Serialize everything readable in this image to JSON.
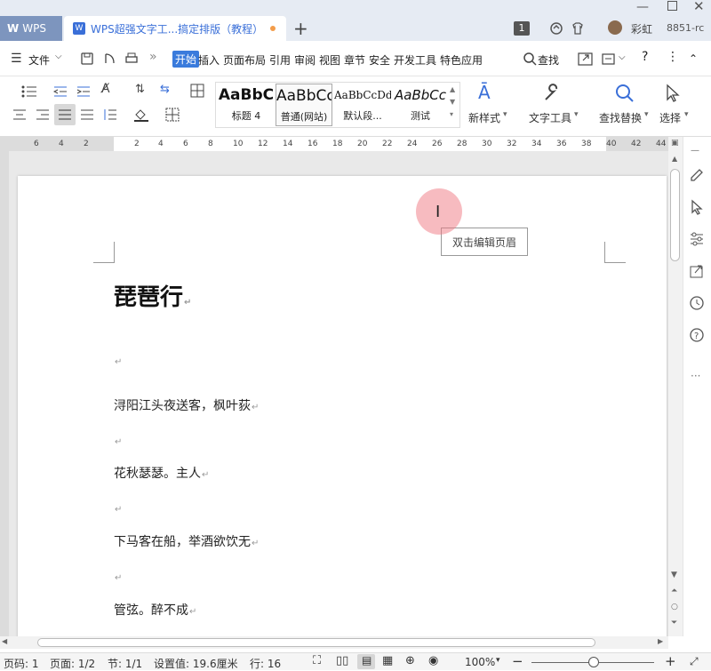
{
  "titlebar": {
    "app_tab": "WPS",
    "doc_tab": "WPS超强文字工...搞定排版（教程）",
    "add_tab": "+",
    "badge_num": "1",
    "user_name": "彩虹",
    "user_id": "8851-rc"
  },
  "menubar": {
    "file": "文件",
    "more": "»",
    "items": [
      "开始",
      "插入",
      "页面布局",
      "引用",
      "审阅",
      "视图",
      "章节",
      "安全",
      "开发工具",
      "特色应用"
    ],
    "search": "查找",
    "help": "?",
    "overflow": "⋮"
  },
  "ribbon": {
    "styles": [
      {
        "preview": "AaBbC",
        "label": "标题 4"
      },
      {
        "preview": "AaBbCcI",
        "label": "普通(网站)"
      },
      {
        "preview": "AaBbCcDd",
        "label": "默认段..."
      },
      {
        "preview": "AaBbCc",
        "label": "测试"
      }
    ],
    "new_style": "新样式",
    "text_tools": "文字工具",
    "find_replace": "查找替换",
    "select": "选择"
  },
  "ruler_ticks": [
    "6",
    "4",
    "2",
    "2",
    "4",
    "6",
    "8",
    "10",
    "12",
    "14",
    "16",
    "18",
    "20",
    "22",
    "24",
    "26",
    "28",
    "30",
    "32",
    "34",
    "36",
    "38",
    "40",
    "42",
    "44"
  ],
  "document": {
    "tooltip": "双击编辑页眉",
    "title": "琵琶行",
    "para_mark": "↵",
    "lines": [
      "浔阳江头夜送客，枫叶荻",
      "花秋瑟瑟。主人",
      "下马客在船，举酒欲饮无",
      "管弦。醉不成"
    ]
  },
  "status": {
    "page_no": "页码: 1",
    "page": "页面: 1/2",
    "section": "节: 1/1",
    "setting": "设置值: 19.6厘米",
    "row": "行: 16",
    "zoom": "100%",
    "minus": "−",
    "plus": "+"
  }
}
